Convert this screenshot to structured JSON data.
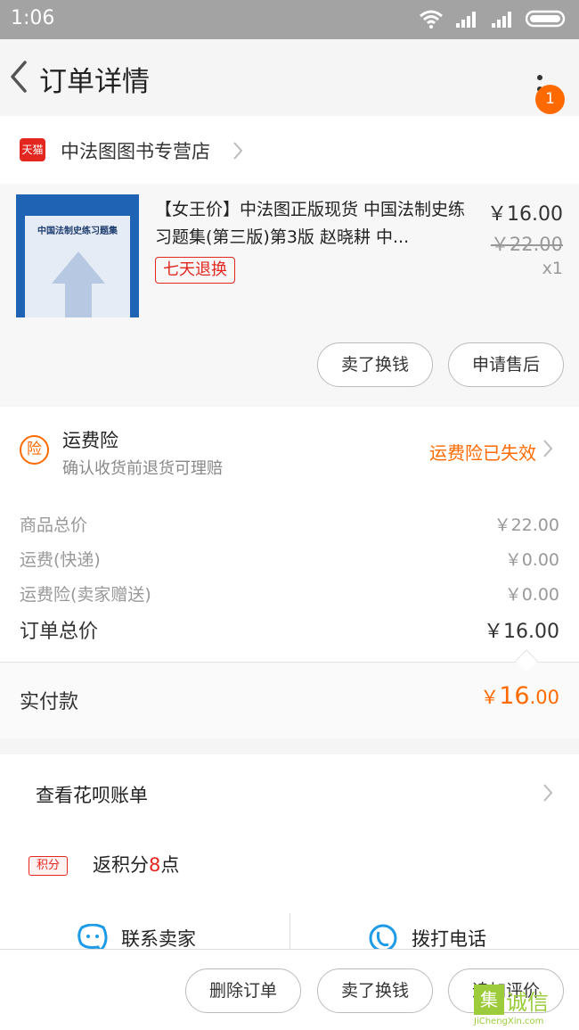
{
  "status_bar": {
    "time": "1:06"
  },
  "header": {
    "title": "订单详情",
    "badge_count": "1"
  },
  "shop": {
    "logo_text": "天猫",
    "name": "中法图图书专营店"
  },
  "product": {
    "cover_title": "中国法制史练习题集",
    "name": "【女王价】中法图正版现货 中国法制史练习题集(第三版)第3版 赵晓耕 中...",
    "tag": "七天退换",
    "price": "￥16.00",
    "original_price": "￥22.00",
    "quantity": "x1",
    "actions": [
      "卖了换钱",
      "申请售后"
    ]
  },
  "insurance": {
    "icon_text": "险",
    "name": "运费险",
    "description": "确认收货前退货可理赔",
    "status": "运费险已失效"
  },
  "summary": {
    "rows": [
      {
        "label": "商品总价",
        "value": "￥22.00"
      },
      {
        "label": "运费(快递)",
        "value": "￥0.00"
      },
      {
        "label": "运费险(卖家赠送)",
        "value": "￥0.00"
      }
    ],
    "total_label": "订单总价",
    "total_value": "￥16.00",
    "paid_label": "实付款",
    "paid_symbol": "￥",
    "paid_int": "16",
    "paid_dec": ".00"
  },
  "extra": {
    "huabei": "查看花呗账单",
    "points_tag": "积分",
    "points_prefix": "返积分",
    "points_num": "8",
    "points_suffix": "点",
    "contact_seller": "联系卖家",
    "call_phone": "拨打电话"
  },
  "bottom_actions": [
    "删除订单",
    "卖了换钱",
    "追加评价"
  ],
  "watermark": {
    "mark": "集",
    "cn": "诚信",
    "en": "JiChengXin.com"
  },
  "colors": {
    "accent": "#ff6a00",
    "tmall_red": "#e3271f",
    "status_bar": "#a3a3a3"
  }
}
